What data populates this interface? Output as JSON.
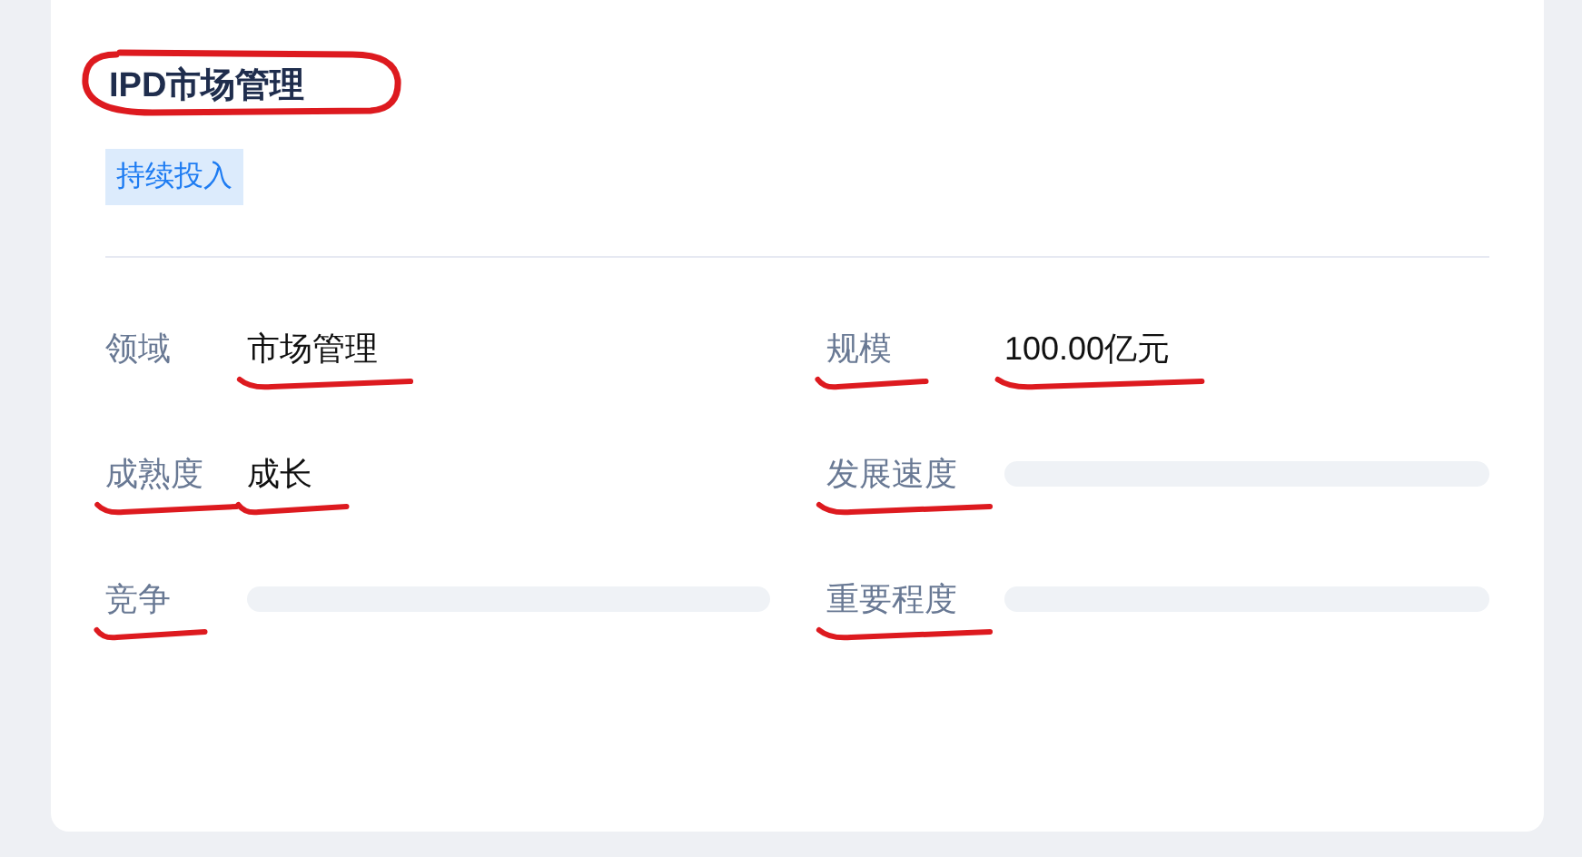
{
  "card": {
    "title": "IPD市场管理",
    "title_circled": true,
    "tag": "持续投入",
    "fields": [
      {
        "label": "领域",
        "kind": "text",
        "value": "市场管理",
        "value_underlined": true
      },
      {
        "label": "规模",
        "kind": "text",
        "value": "100.00亿元",
        "label_underlined": true,
        "value_underlined": true
      },
      {
        "label": "成熟度",
        "kind": "text",
        "value": "成长",
        "label_underlined": true,
        "value_underlined": true
      },
      {
        "label": "发展速度",
        "kind": "skeleton",
        "label_underlined": true
      },
      {
        "label": "竞争",
        "kind": "skeleton",
        "label_underlined": true
      },
      {
        "label": "重要程度",
        "kind": "skeleton",
        "label_underlined": true
      }
    ]
  }
}
